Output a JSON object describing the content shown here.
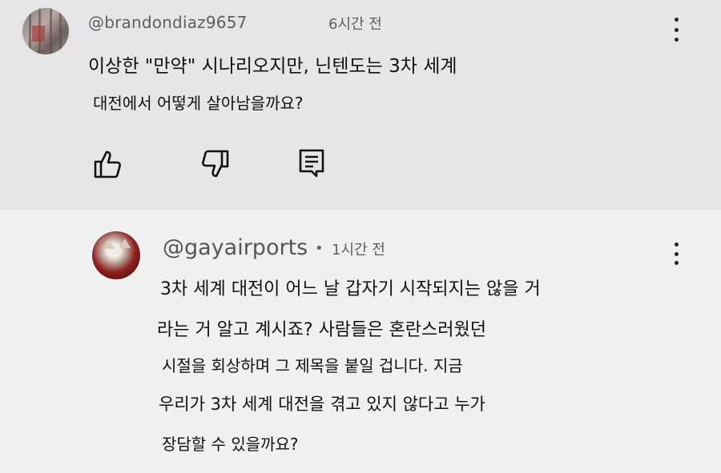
{
  "comment": {
    "author": "@brandondiaz9657",
    "time": "6시간 전",
    "text_lines": [
      "이상한 \"만약\" 시나리오지만, 닌텐도는 3차 세계",
      "대전에서 어떻게 살아남을까요?"
    ],
    "actions": {
      "like_icon": "thumbs-up-icon",
      "dislike_icon": "thumbs-down-icon",
      "reply_icon": "reply-comment-icon"
    }
  },
  "reply": {
    "author": "@gayairports",
    "separator": "•",
    "time": "1시간 전",
    "text_lines": [
      "3차 세계 대전이 어느 날 갑자기 시작되지는 않을 거",
      "라는 거 알고 계시죠? 사람들은 혼란스러웠던",
      "시절을 회상하며 그 제목을 붙일 겁니다. 지금",
      "우리가 3차 세계 대전을 겪고 있지 않다고 누가",
      "장담할 수 있을까요?"
    ]
  },
  "colors": {
    "top_bg": "#e6e6e8",
    "reply_bg": "#f0f0f0",
    "text": "#111111",
    "meta": "#5e5e5e"
  }
}
